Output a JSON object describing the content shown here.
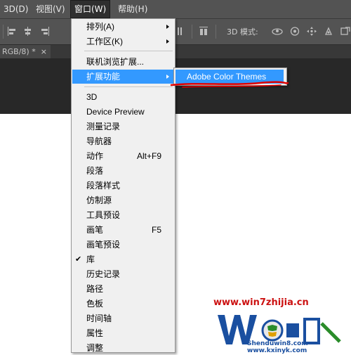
{
  "menubar": {
    "items": [
      {
        "label": "3D(D)",
        "active": false
      },
      {
        "label": "视图(V)",
        "active": false
      },
      {
        "label": "窗口(W)",
        "active": true
      },
      {
        "label": "帮助(H)",
        "active": false
      }
    ]
  },
  "options_bar": {
    "mode_label": "3D 模式:"
  },
  "doc_tab": {
    "title": "RGB/8) *",
    "close": "×"
  },
  "window_menu": {
    "items": [
      {
        "label": "排列(A)",
        "submenu": true
      },
      {
        "label": "工作区(K)",
        "submenu": true
      },
      {
        "label": "联机浏览扩展..."
      },
      {
        "label": "扩展功能",
        "submenu": true,
        "highlighted": true
      },
      {
        "label": "3D"
      },
      {
        "label": "Device Preview"
      },
      {
        "label": "测量记录"
      },
      {
        "label": "导航器"
      },
      {
        "label": "动作",
        "shortcut": "Alt+F9"
      },
      {
        "label": "段落"
      },
      {
        "label": "段落样式"
      },
      {
        "label": "仿制源"
      },
      {
        "label": "工具预设"
      },
      {
        "label": "画笔",
        "shortcut": "F5"
      },
      {
        "label": "画笔预设"
      },
      {
        "label": "库",
        "checked": true,
        "check": "✔"
      },
      {
        "label": "历史记录"
      },
      {
        "label": "路径"
      },
      {
        "label": "色板"
      },
      {
        "label": "时间轴"
      },
      {
        "label": "属性"
      },
      {
        "label": "调整"
      }
    ]
  },
  "extensions_submenu": {
    "item": "Adobe Color Themes"
  },
  "colors": {
    "highlight": "#3399ff",
    "underline": "#e00000",
    "watermark_red": "#cc1111",
    "watermark_blue": "#1a4fa0"
  },
  "watermark": {
    "url": "www.win7zhijia.cn",
    "brand": "Shenduwin8.com",
    "url2": "www.kxinyk.com"
  }
}
